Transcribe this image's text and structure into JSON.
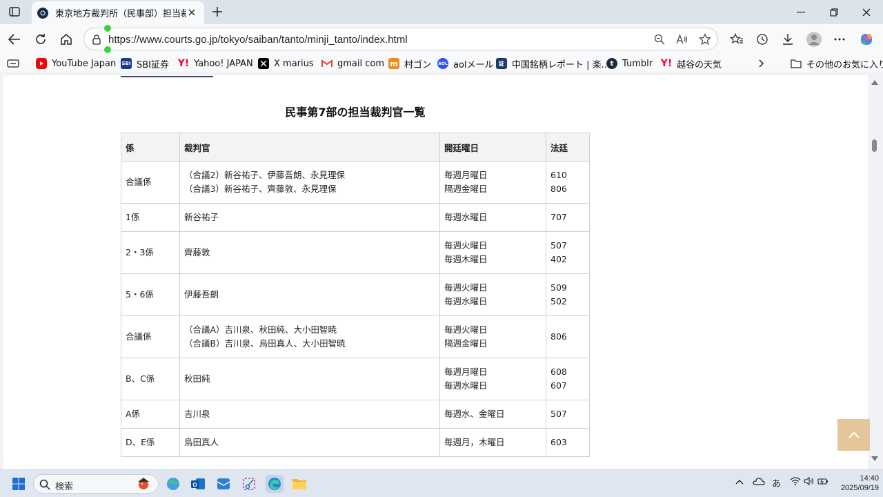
{
  "browser": {
    "tab_title": "東京地方裁判所（民事部）担当裁",
    "url": "https://www.courts.go.jp/tokyo/saiban/tanto/minji_tanto/index.html"
  },
  "bookmarks": [
    {
      "label": "YouTube Japan",
      "icon": "youtube-icon",
      "color": "#ff0000"
    },
    {
      "label": "SBI証券",
      "icon": "sbi-icon",
      "color": "#1b3c8c"
    },
    {
      "label": "Yahoo! JAPAN",
      "icon": "yahoo-icon",
      "color": "#ff0033"
    },
    {
      "label": "X marius",
      "icon": "x-icon",
      "color": "#000000"
    },
    {
      "label": "gmail com",
      "icon": "gmail-icon",
      "color": "#ea4335"
    },
    {
      "label": "村ゴン",
      "icon": "murakon-icon",
      "color": "#f28b1c"
    },
    {
      "label": "aolメール",
      "icon": "aol-icon",
      "color": "#2b50ff"
    },
    {
      "label": "中国銘柄レポート | 楽...",
      "icon": "rakuten-report-icon",
      "color": "#1e3a6e"
    },
    {
      "label": "Tumblr",
      "icon": "tumblr-icon",
      "color": "#1d2a3a"
    },
    {
      "label": "越谷の天気",
      "icon": "yahoo-weather-icon",
      "color": "#ff0033"
    }
  ],
  "other_favorites": "その他のお気に入り",
  "page": {
    "heading": "民事第7部の担当裁判官一覧",
    "table": {
      "headers": [
        "係",
        "裁判官",
        "開廷曜日",
        "法廷"
      ],
      "rows": [
        {
          "kakari": "合議係",
          "judges": [
            "（合議2）新谷祐子、伊藤吾朗、永見理保",
            "（合議3）新谷祐子、齊藤敦、永見理保"
          ],
          "days": [
            "毎週月曜日",
            "隔週金曜日"
          ],
          "court": [
            "610",
            "806"
          ]
        },
        {
          "kakari": "1係",
          "judges": [
            "新谷祐子"
          ],
          "days": [
            "毎週水曜日"
          ],
          "court": [
            "707"
          ]
        },
        {
          "kakari": "2・3係",
          "judges": [
            "齊藤敦"
          ],
          "days": [
            "毎週火曜日",
            "毎週木曜日"
          ],
          "court": [
            "507",
            "402"
          ]
        },
        {
          "kakari": "5・6係",
          "judges": [
            "伊藤吾朗"
          ],
          "days": [
            "毎週火曜日",
            "毎週水曜日"
          ],
          "court": [
            "509",
            "502"
          ]
        },
        {
          "kakari": "合議係",
          "judges": [
            "（合議A）吉川泉、秋田純、大小田智暁",
            "（合議B）吉川泉、烏田真人、大小田智暁"
          ],
          "days": [
            "毎週火曜日",
            "隔週金曜日"
          ],
          "court": [
            "806"
          ]
        },
        {
          "kakari": "B、C係",
          "judges": [
            "秋田純"
          ],
          "days": [
            "毎週月曜日",
            "毎週水曜日"
          ],
          "court": [
            "608",
            "607"
          ]
        },
        {
          "kakari": "A係",
          "judges": [
            "吉川泉"
          ],
          "days": [
            "毎週水、金曜日"
          ],
          "court": [
            "507"
          ]
        },
        {
          "kakari": "D、E係",
          "judges": [
            "烏田真人"
          ],
          "days": [
            "毎週月，木曜日"
          ],
          "court": [
            "603"
          ]
        }
      ]
    },
    "accent_color": "#e3c79a"
  },
  "taskbar": {
    "search_placeholder": "検索",
    "ime": "あ",
    "time": "14:40",
    "date": "2025/09/19"
  }
}
